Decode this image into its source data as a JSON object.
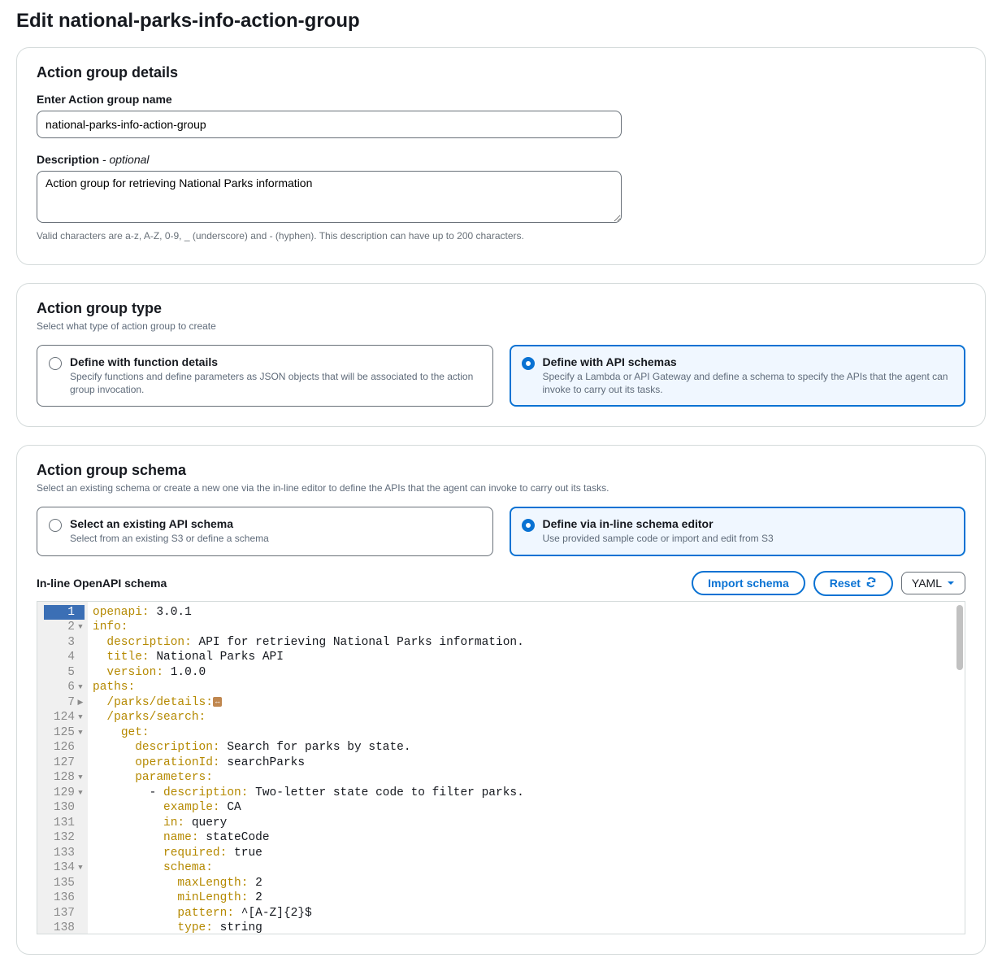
{
  "page": {
    "title": "Edit national-parks-info-action-group"
  },
  "details": {
    "heading": "Action group details",
    "name_label": "Enter Action group name",
    "name_value": "national-parks-info-action-group",
    "desc_label": "Description",
    "desc_optional": " - optional",
    "desc_value": "Action group for retrieving National Parks information",
    "help": "Valid characters are a-z, A-Z, 0-9, _ (underscore) and - (hyphen). This description can have up to 200 characters."
  },
  "type": {
    "heading": "Action group type",
    "sub": "Select what type of action group to create",
    "options": [
      {
        "title": "Define with function details",
        "desc": "Specify functions and define parameters as JSON objects that will be associated to the action group invocation.",
        "selected": false
      },
      {
        "title": "Define with API schemas",
        "desc": "Specify a Lambda or API Gateway and define a schema to specify the APIs that the agent can invoke to carry out its tasks.",
        "selected": true
      }
    ]
  },
  "schema": {
    "heading": "Action group schema",
    "sub": "Select an existing schema or create a new one via the in-line editor to define the APIs that the agent can invoke to carry out its tasks.",
    "options": [
      {
        "title": "Select an existing API schema",
        "desc": "Select from an existing S3 or define a schema",
        "selected": false
      },
      {
        "title": "Define via in-line schema editor",
        "desc": "Use provided sample code or import and edit from S3",
        "selected": true
      }
    ]
  },
  "toolbar": {
    "label": "In-line OpenAPI schema",
    "import": "Import schema",
    "reset": "Reset",
    "format": "YAML"
  },
  "code": {
    "lines": [
      {
        "n": "1",
        "fold": "",
        "active": true,
        "tokens": [
          [
            "key",
            "openapi:"
          ],
          [
            "str",
            " 3.0.1"
          ]
        ]
      },
      {
        "n": "2",
        "fold": "▼",
        "tokens": [
          [
            "key",
            "info:"
          ]
        ]
      },
      {
        "n": "3",
        "fold": "",
        "tokens": [
          [
            "pad",
            "  "
          ],
          [
            "key",
            "description:"
          ],
          [
            "str",
            " API for retrieving National Parks information."
          ]
        ]
      },
      {
        "n": "4",
        "fold": "",
        "tokens": [
          [
            "pad",
            "  "
          ],
          [
            "key",
            "title:"
          ],
          [
            "str",
            " National Parks API"
          ]
        ]
      },
      {
        "n": "5",
        "fold": "",
        "tokens": [
          [
            "pad",
            "  "
          ],
          [
            "key",
            "version:"
          ],
          [
            "str",
            " 1.0.0"
          ]
        ]
      },
      {
        "n": "6",
        "fold": "▼",
        "tokens": [
          [
            "key",
            "paths:"
          ]
        ]
      },
      {
        "n": "7",
        "fold": "▶",
        "tokens": [
          [
            "pad",
            "  "
          ],
          [
            "key",
            "/parks/details:"
          ],
          [
            "foldmark",
            "···"
          ]
        ]
      },
      {
        "n": "124",
        "fold": "▼",
        "tokens": [
          [
            "pad",
            "  "
          ],
          [
            "key",
            "/parks/search:"
          ]
        ]
      },
      {
        "n": "125",
        "fold": "▼",
        "tokens": [
          [
            "pad",
            "    "
          ],
          [
            "key",
            "get:"
          ]
        ]
      },
      {
        "n": "126",
        "fold": "",
        "tokens": [
          [
            "pad",
            "      "
          ],
          [
            "key",
            "description:"
          ],
          [
            "str",
            " Search for parks by state."
          ]
        ]
      },
      {
        "n": "127",
        "fold": "",
        "tokens": [
          [
            "pad",
            "      "
          ],
          [
            "key",
            "operationId:"
          ],
          [
            "str",
            " searchParks"
          ]
        ]
      },
      {
        "n": "128",
        "fold": "▼",
        "tokens": [
          [
            "pad",
            "      "
          ],
          [
            "key",
            "parameters:"
          ]
        ]
      },
      {
        "n": "129",
        "fold": "▼",
        "tokens": [
          [
            "pad",
            "        - "
          ],
          [
            "key",
            "description:"
          ],
          [
            "str",
            " Two-letter state code to filter parks."
          ]
        ]
      },
      {
        "n": "130",
        "fold": "",
        "tokens": [
          [
            "pad",
            "          "
          ],
          [
            "key",
            "example:"
          ],
          [
            "str",
            " CA"
          ]
        ]
      },
      {
        "n": "131",
        "fold": "",
        "tokens": [
          [
            "pad",
            "          "
          ],
          [
            "key",
            "in:"
          ],
          [
            "str",
            " query"
          ]
        ]
      },
      {
        "n": "132",
        "fold": "",
        "tokens": [
          [
            "pad",
            "          "
          ],
          [
            "key",
            "name:"
          ],
          [
            "str",
            " stateCode"
          ]
        ]
      },
      {
        "n": "133",
        "fold": "",
        "tokens": [
          [
            "pad",
            "          "
          ],
          [
            "key",
            "required:"
          ],
          [
            "bool",
            " true"
          ]
        ]
      },
      {
        "n": "134",
        "fold": "▼",
        "tokens": [
          [
            "pad",
            "          "
          ],
          [
            "key",
            "schema:"
          ]
        ]
      },
      {
        "n": "135",
        "fold": "",
        "tokens": [
          [
            "pad",
            "            "
          ],
          [
            "key",
            "maxLength:"
          ],
          [
            "num",
            " 2"
          ]
        ]
      },
      {
        "n": "136",
        "fold": "",
        "tokens": [
          [
            "pad",
            "            "
          ],
          [
            "key",
            "minLength:"
          ],
          [
            "num",
            " 2"
          ]
        ]
      },
      {
        "n": "137",
        "fold": "",
        "tokens": [
          [
            "pad",
            "            "
          ],
          [
            "key",
            "pattern:"
          ],
          [
            "str",
            " ^[A-Z]{2}$"
          ]
        ]
      },
      {
        "n": "138",
        "fold": "",
        "tokens": [
          [
            "pad",
            "            "
          ],
          [
            "key",
            "type:"
          ],
          [
            "str",
            " string"
          ]
        ]
      }
    ]
  }
}
